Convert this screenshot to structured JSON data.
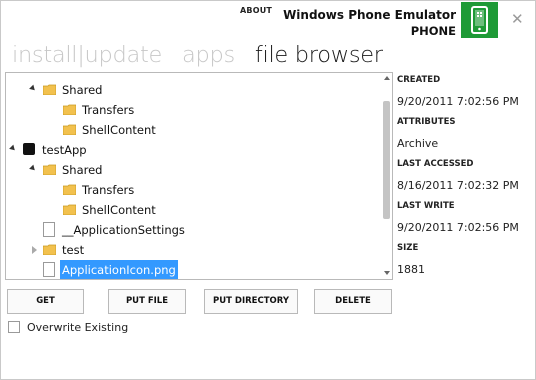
{
  "header": {
    "about_label": "ABOUT",
    "device_name": "Windows Phone Emulator",
    "device_type": "PHONE",
    "phone_icon": "phone-icon",
    "close_icon": "close-icon",
    "accent_color": "#1e9a36"
  },
  "nav": {
    "tabs": [
      {
        "label": "install|update"
      },
      {
        "label": "apps"
      },
      {
        "label": "file browser"
      }
    ],
    "active_tab": "file browser"
  },
  "tree": {
    "items": [
      {
        "label": "Shared",
        "kind": "folder",
        "expanded": true
      },
      {
        "label": "Transfers",
        "kind": "folder"
      },
      {
        "label": "ShellContent",
        "kind": "folder"
      },
      {
        "label": "testApp",
        "kind": "app",
        "expanded": true
      },
      {
        "label": "Shared",
        "kind": "folder",
        "expanded": true
      },
      {
        "label": "Transfers",
        "kind": "folder"
      },
      {
        "label": "ShellContent",
        "kind": "folder"
      },
      {
        "label": "__ApplicationSettings",
        "kind": "file"
      },
      {
        "label": "test",
        "kind": "folder",
        "expanded": false
      },
      {
        "label": "ApplicationIcon.png",
        "kind": "file",
        "selected": true
      }
    ],
    "selection_color": "#3399ff"
  },
  "details": {
    "created_label": "CREATED",
    "created_value": "9/20/2011 7:02:56 PM",
    "attributes_label": "ATTRIBUTES",
    "attributes_value": "Archive",
    "last_accessed_label": "LAST ACCESSED",
    "last_accessed_value": "8/16/2011 7:02:32 PM",
    "last_write_label": "LAST WRITE",
    "last_write_value": "9/20/2011 7:02:56 PM",
    "size_label": "SIZE",
    "size_value": "1881"
  },
  "actions": {
    "get_label": "GET",
    "put_file_label": "PUT FILE",
    "put_directory_label": "PUT DIRECTORY",
    "delete_label": "DELETE",
    "overwrite_label": "Overwrite Existing",
    "overwrite_checked": false
  }
}
